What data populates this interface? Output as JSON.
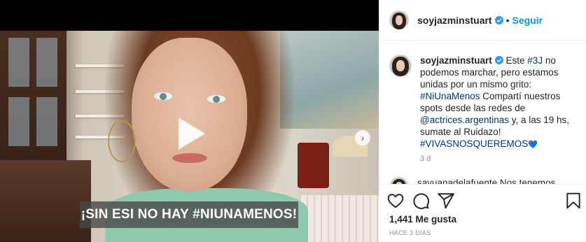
{
  "video": {
    "caption": "¡SIN ESI NO HAY #NIUNAMENOS!",
    "play_icon": "play-icon",
    "next_icon": "chevron-right-icon"
  },
  "header": {
    "username": "soyjazminstuart",
    "separator": "•",
    "follow_label": "Seguir"
  },
  "post": {
    "username": "soyjazminstuart",
    "text_1": " Este ",
    "tag_3j": "#3J",
    "text_2": " no podemos marchar, pero estamos unidas por un mismo grito: ",
    "tag_niunamenos": "#NiUnaMenos",
    "text_3": " Compartí nuestros spots desde las redes de ",
    "mention": "@actrices.argentinas",
    "text_4": " y, a las 19 hs, sumate al Ruidazo! ",
    "tag_vivas": "#VIVASNOSQUEREMOS",
    "emoji": "💙",
    "time": "3 d"
  },
  "next_comment": {
    "text": "sayuanadelafuente Nos tenemos"
  },
  "actions": {
    "like_icon": "heart-icon",
    "comment_icon": "comment-icon",
    "share_icon": "share-icon",
    "save_icon": "bookmark-icon"
  },
  "likes": "1,441 Me gusta",
  "ago": "HACE 3 DÍAS",
  "colors": {
    "link": "#0095f6",
    "tag": "#00376b",
    "muted": "#8e8e8e"
  }
}
